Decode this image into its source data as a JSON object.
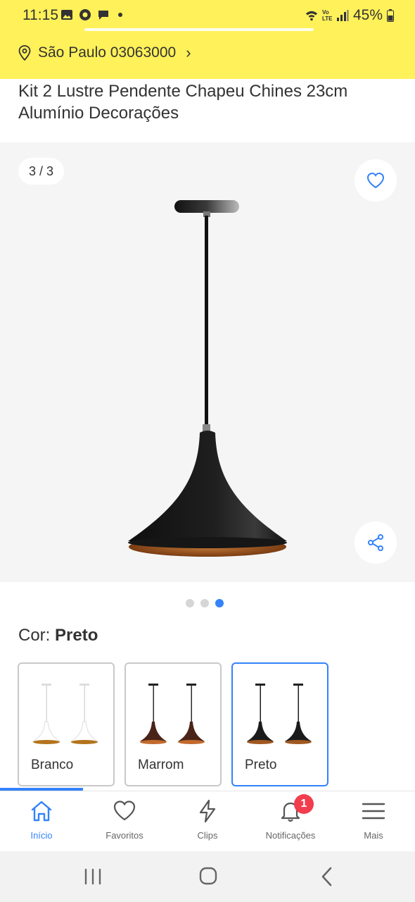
{
  "status_bar": {
    "time": "11:15",
    "battery": "45%",
    "network": "Vo LTE"
  },
  "location": {
    "text": "São Paulo 03063000"
  },
  "product": {
    "title": "Kit 2 Lustre Pendente Chapeu Chines 23cm Alumínio Decorações"
  },
  "gallery": {
    "counter": "3 / 3",
    "current_index": 3,
    "total": 3
  },
  "color": {
    "label": "Cor:",
    "selected": "Preto",
    "options": [
      {
        "label": "Branco",
        "shade": "#ffffff",
        "inner": "#b3741d",
        "cord": "#d9d9d9"
      },
      {
        "label": "Marrom",
        "shade": "#4a2418",
        "inner": "#c26a2d",
        "cord": "#2b2b2b"
      },
      {
        "label": "Preto",
        "shade": "#1b1b1b",
        "inner": "#a0581f",
        "cord": "#1b1b1b"
      }
    ]
  },
  "tabs": [
    {
      "label": "Início",
      "icon": "home-icon"
    },
    {
      "label": "Favoritos",
      "icon": "heart-icon"
    },
    {
      "label": "Clips",
      "icon": "lightning-icon"
    },
    {
      "label": "Notificações",
      "icon": "bell-icon",
      "badge": "1"
    },
    {
      "label": "Mais",
      "icon": "menu-icon"
    }
  ],
  "colors": {
    "brand_yellow": "#fff159",
    "accent_blue": "#3483fa",
    "badge_red": "#f23d4f",
    "copper": "#b0632a"
  }
}
